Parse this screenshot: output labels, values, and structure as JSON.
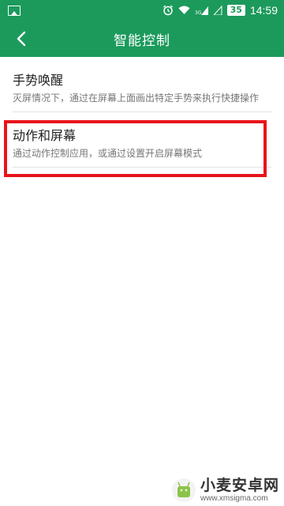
{
  "status_bar": {
    "icons": [
      "gallery-icon",
      "alarm-icon",
      "wifi-icon",
      "signal-icon"
    ],
    "network_label": "3G",
    "battery_level": "35",
    "time": "14:59"
  },
  "toolbar": {
    "back_icon": "chevron-left-icon",
    "title": "智能控制"
  },
  "items": [
    {
      "title": "手势唤醒",
      "description": "灭屏情况下，通过在屏幕上面画出特定手势来执行快捷操作"
    },
    {
      "title": "动作和屏幕",
      "description": "通过动作控制应用，或通过设置开启屏幕模式"
    }
  ],
  "highlight_color": "#e8141b",
  "accent_color": "#1c9a5c",
  "watermark": {
    "name": "小麦安卓网",
    "url": "www.xmsigma.com"
  }
}
